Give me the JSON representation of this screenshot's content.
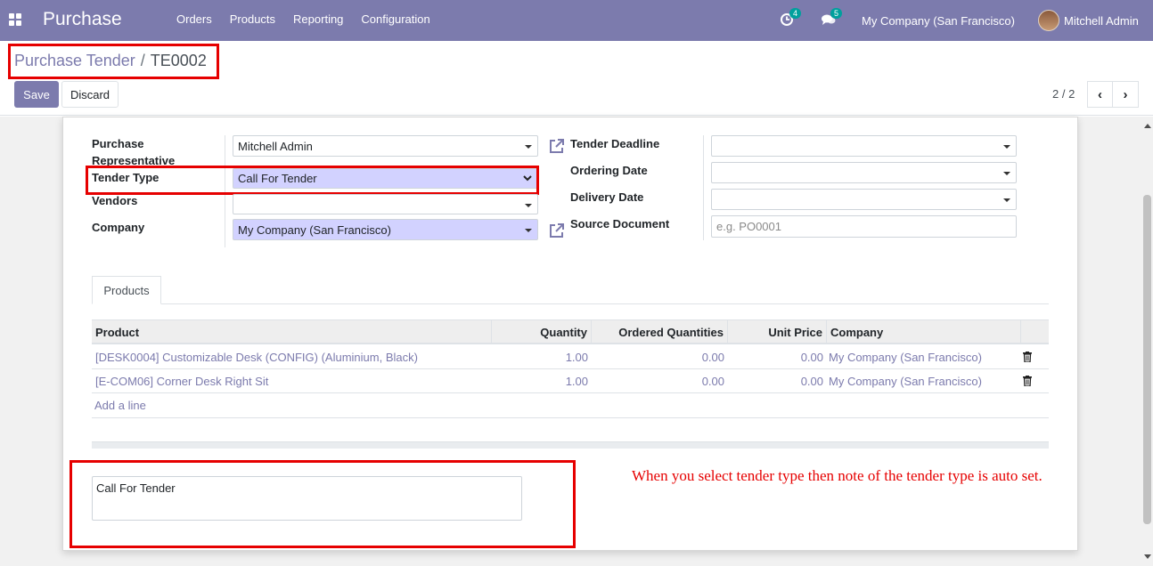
{
  "navbar": {
    "brand": "Purchase",
    "menu": [
      "Orders",
      "Products",
      "Reporting",
      "Configuration"
    ],
    "activity_count": "4",
    "message_count": "5",
    "company": "My Company (San Francisco)",
    "user": "Mitchell Admin"
  },
  "breadcrumb": {
    "parent": "Purchase Tender",
    "separator": "/",
    "current": "TE0002"
  },
  "buttons": {
    "save": "Save",
    "discard": "Discard"
  },
  "pager": {
    "value": "2 / 2",
    "prev": "‹",
    "next": "›"
  },
  "form": {
    "purchase_rep_label": "Purchase Representative",
    "purchase_rep_value": "Mitchell Admin",
    "tender_type_label": "Tender Type",
    "tender_type_value": "Call For Tender",
    "vendors_label": "Vendors",
    "vendors_value": "",
    "company_label": "Company",
    "company_value": "My Company (San Francisco)",
    "deadline_label": "Tender Deadline",
    "deadline_value": "",
    "ordering_label": "Ordering Date",
    "ordering_value": "",
    "delivery_label": "Delivery Date",
    "delivery_value": "",
    "source_label": "Source Document",
    "source_placeholder": "e.g. PO0001"
  },
  "tabs": [
    "Products"
  ],
  "table": {
    "columns": [
      "Product",
      "Quantity",
      "Ordered Quantities",
      "Unit Price",
      "Company"
    ],
    "rows": [
      {
        "product": "[DESK0004] Customizable Desk (CONFIG) (Aluminium, Black)",
        "quantity": "1.00",
        "ordered": "0.00",
        "price": "0.00",
        "company": "My Company (San Francisco)"
      },
      {
        "product": "[E-COM06] Corner Desk Right Sit",
        "quantity": "1.00",
        "ordered": "0.00",
        "price": "0.00",
        "company": "My Company (San Francisco)"
      }
    ],
    "add_line": "Add a line"
  },
  "note": {
    "value": "Call For Tender"
  },
  "annotation": "When you select tender type then note of the tender type is auto set.",
  "colors": {
    "primary": "#7c7bad",
    "highlight": "#e60000",
    "required_bg": "#d2d2ff"
  }
}
